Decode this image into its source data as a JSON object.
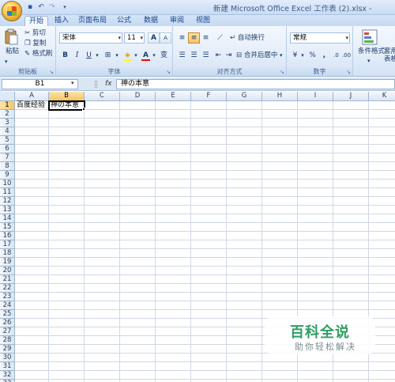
{
  "titlebar": {
    "title": "新建 Microsoft Office Excel 工作表 (2).xlsx -",
    "qat_icons": [
      "save-icon",
      "undo-icon",
      "redo-icon",
      "customize-icon"
    ]
  },
  "tabs": [
    {
      "label": "开始",
      "active": true
    },
    {
      "label": "插入"
    },
    {
      "label": "页面布局"
    },
    {
      "label": "公式"
    },
    {
      "label": "数据"
    },
    {
      "label": "审阅"
    },
    {
      "label": "视图"
    }
  ],
  "ribbon": {
    "clipboard": {
      "group_label": "剪贴板",
      "paste_label": "粘贴",
      "cut_label": "剪切",
      "copy_label": "复制",
      "format_painter_label": "格式刷"
    },
    "font": {
      "group_label": "字体",
      "font_name": "宋体",
      "font_size": "11",
      "grow_label": "A",
      "shrink_label": "A",
      "bold_label": "B",
      "italic_label": "I",
      "underline_label": "U",
      "font_color_label": "A",
      "phonetic_label": "变"
    },
    "alignment": {
      "group_label": "对齐方式",
      "wrap_text_label": "自动换行",
      "merge_center_label": "合并后居中"
    },
    "number": {
      "group_label": "数字",
      "format": "常规",
      "percent_label": "%",
      "comma_label": ","
    },
    "styles": {
      "conditional_format_label": "条件格式",
      "table_format_label": "套用\n表格"
    }
  },
  "formula_bar": {
    "name_box": "B1",
    "fx_label": "fx",
    "content": "神の本意"
  },
  "sheet": {
    "columns": [
      "A",
      "B",
      "C",
      "D",
      "E",
      "F",
      "G",
      "H",
      "I",
      "J",
      "K"
    ],
    "rows": [
      "1",
      "2",
      "3",
      "4",
      "5",
      "6",
      "7",
      "8",
      "9",
      "10",
      "11",
      "12",
      "13",
      "14",
      "15",
      "16",
      "17",
      "18",
      "19",
      "20",
      "21",
      "22",
      "23",
      "24",
      "25",
      "26",
      "27",
      "28",
      "29",
      "30",
      "31",
      "32",
      "33"
    ],
    "selected_column": "B",
    "selected_row": "1",
    "cells": {
      "A1": "百度经验",
      "B1": "神の本意"
    }
  },
  "watermark": {
    "title": "百科全说",
    "subtitle": "助你轻松解决"
  }
}
